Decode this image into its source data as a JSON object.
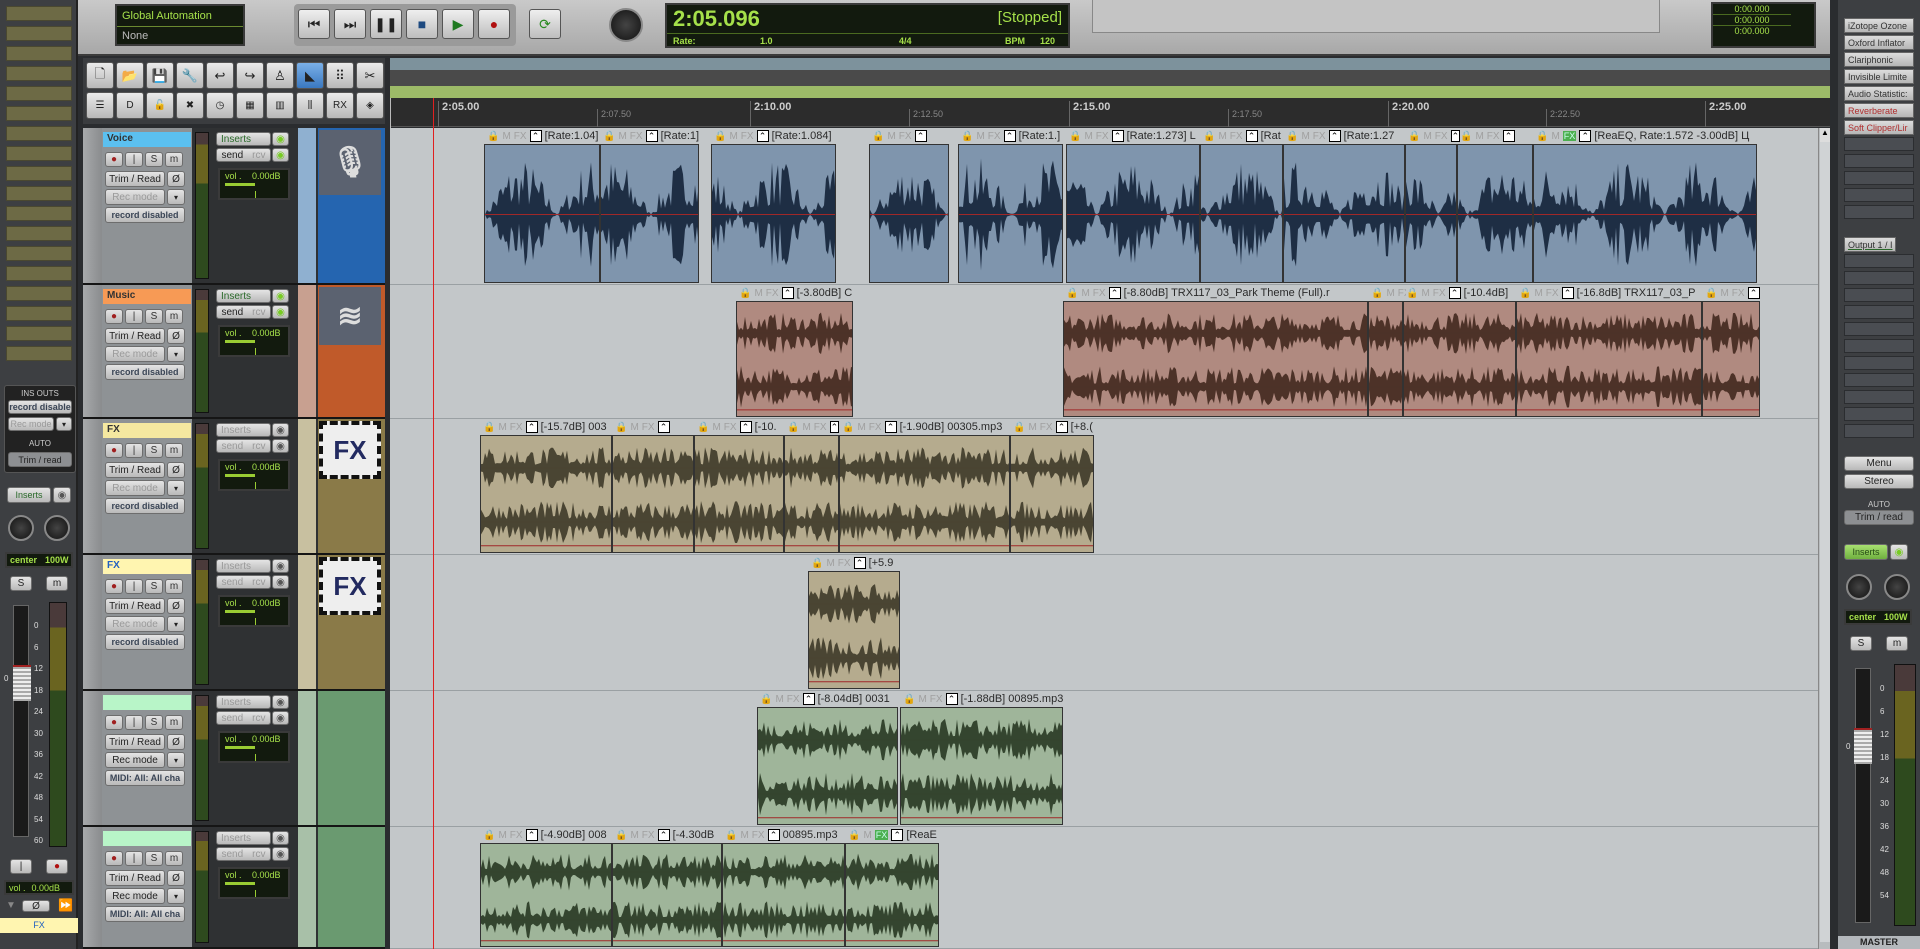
{
  "global_automation": {
    "title": "Global Automation",
    "value": "None"
  },
  "transport": {
    "buttons": [
      "go-to-start",
      "go-to-end",
      "pause",
      "stop",
      "play",
      "record"
    ],
    "loop": "repeat-toggle"
  },
  "time_display": {
    "position": "2:05.096",
    "state": "[Stopped]",
    "rate_label": "Rate:",
    "rate": "1.0",
    "signature": "4/4",
    "bpm_label": "BPM",
    "bpm": "120"
  },
  "selection_display": {
    "start": "0:00.000",
    "end": "0:00.000",
    "length": "0:00.000"
  },
  "toolbar": {
    "row1": [
      "new-project",
      "open-project",
      "save-project",
      "project-settings",
      "undo",
      "redo",
      "metronome",
      "auto-crossfade",
      "snap-grid",
      "ripple-edit"
    ],
    "row2": [
      "grid-lines",
      "loop-points",
      "lock",
      "remove-fx",
      "time-stretch",
      "color-tracks",
      "color-picker",
      "dynamic-split",
      "RX",
      "render"
    ],
    "rx_label": "RX"
  },
  "ruler": {
    "ticks": [
      {
        "label": "2:05.00",
        "major": true
      },
      {
        "label": "2:07.50",
        "major": false
      },
      {
        "label": "2:10.00",
        "major": true
      },
      {
        "label": "2:12.50",
        "major": false
      },
      {
        "label": "2:15.00",
        "major": true
      },
      {
        "label": "2:17.50",
        "major": false
      },
      {
        "label": "2:20.00",
        "major": true
      },
      {
        "label": "2:22.50",
        "major": false
      },
      {
        "label": "2:25.00",
        "major": true
      }
    ]
  },
  "track_common": {
    "inserts": "Inserts",
    "send": "send",
    "rcv": "rcv",
    "vol": "vol .",
    "vol_value": "0.00dB",
    "trim_read": "Trim / Read",
    "rec_mode": "Rec mode",
    "phase": "Ø",
    "rec": "●",
    "input": "|",
    "solo": "S",
    "mute": "m"
  },
  "tracks": [
    {
      "name": "Voice",
      "status": "record disabled",
      "color": "#5bc0f0",
      "icon": "microphone-icon",
      "items": [
        "[Rate:1.04]",
        "[Rate:1]",
        "[Rate:1.084]",
        "",
        "[Rate:1.]",
        "[Rate:1.273] L",
        "[Rat",
        "[Rate:1.27",
        "",
        "",
        "[ReaEQ, Rate:1.572 -3.00dB] Ц"
      ]
    },
    {
      "name": "Music",
      "status": "record disabled",
      "color": "#f79a55",
      "icon": "waveform-icon",
      "items": [
        "[-3.80dB] C",
        "[-8.80dB] TRX117_03_Park Theme (Full).r",
        "",
        "[-10.4dB]",
        "[-16.8dB] TRX117_03_P",
        ""
      ]
    },
    {
      "name": "FX",
      "status": "record disabled",
      "color": "#f5e8a0",
      "icon": "fx-icon",
      "items": [
        "[-15.7dB] 003",
        "",
        "[-10.",
        "",
        "[-1.90dB] 00305.mp3",
        "[+8.("
      ]
    },
    {
      "name": "FX",
      "status": "record disabled",
      "color": "#fff5b0",
      "icon": "fx-icon",
      "items": [
        "[+5.9"
      ]
    },
    {
      "name": "",
      "status": "MIDI: All: All cha",
      "color": "#b8f5c8",
      "icon": "",
      "items": [
        "[-8.04dB] 0031",
        "[-1.88dB] 00895.mp3"
      ]
    },
    {
      "name": "",
      "status": "MIDI: All: All cha",
      "color": "#b8f5c8",
      "icon": "",
      "items": [
        "[-4.90dB] 008",
        "[-4.30dB",
        "00895.mp3",
        "[ReaE"
      ]
    }
  ],
  "left_mixer": {
    "ins_outs": "INS  OUTS",
    "record": "record disable",
    "rec_mode": "Rec mode",
    "auto": "AUTO",
    "auto_mode": "Trim / read",
    "inserts": "Inserts",
    "pan": "center",
    "width": "100W",
    "solo": "S",
    "mute": "m",
    "scale": [
      "0",
      "6",
      "12",
      "18",
      "24",
      "30",
      "36",
      "42",
      "48",
      "54",
      "60"
    ],
    "fader_zero": "0",
    "vol": "vol .",
    "vol_value": "0.00dB",
    "phase": "Ø",
    "track_name": "FX"
  },
  "master": {
    "fx": [
      "iZotope Ozone",
      "Oxford Inflator",
      "Clariphonic",
      "Invisible Limite",
      "Audio Statistic:",
      "Reverberate",
      "Soft Clipper/Lir"
    ],
    "fx_disabled_color": "#b03030",
    "output": "Output 1 / I",
    "menu": "Menu",
    "stereo": "Stereo",
    "auto": "AUTO",
    "auto_mode": "Trim / read",
    "inserts": "Inserts",
    "pan": "center",
    "width": "100W",
    "solo": "S",
    "mute": "m",
    "scale": [
      "0",
      "6",
      "12",
      "18",
      "24",
      "30",
      "36",
      "42",
      "48",
      "54"
    ],
    "fader_zero": "0",
    "name": "MASTER"
  }
}
